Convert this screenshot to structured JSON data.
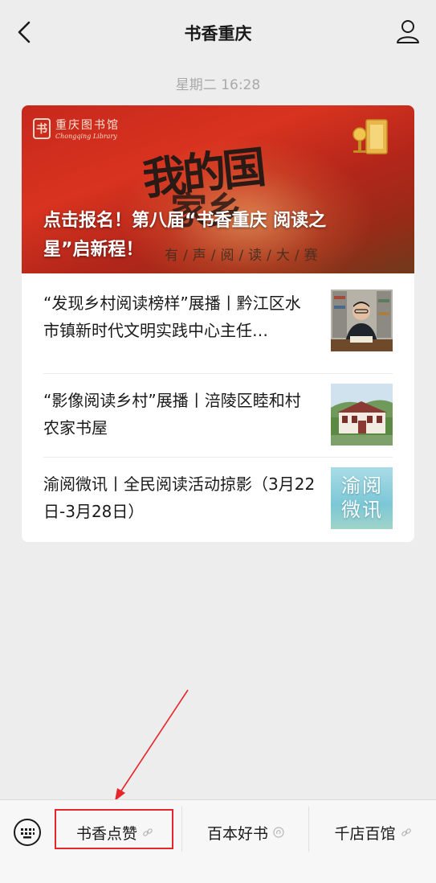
{
  "header": {
    "title": "书香重庆"
  },
  "timestamp": "星期二 16:28",
  "cover": {
    "title": "点击报名！第八届“书香重庆 阅读之星”启新程！",
    "logo_cn": "重庆图书馆",
    "logo_en": "Chongqing Library",
    "art_line1": "我的国",
    "art_line2": "家乡",
    "art_sub": "有/声/阅/读/大/赛"
  },
  "articles": [
    {
      "title": "“发现乡村阅读榜样”展播丨黔江区水市镇新时代文明实践中心主任…"
    },
    {
      "title": "“影像阅读乡村”展播丨涪陵区睦和村农家书屋"
    },
    {
      "title": "渝阅微讯丨全民阅读活动掠影（3月22日-3月28日）",
      "thumb_text": "渝阅微讯"
    }
  ],
  "menu": {
    "items": [
      {
        "label": "书香点赞"
      },
      {
        "label": "百本好书"
      },
      {
        "label": "千店百馆"
      }
    ]
  },
  "colors": {
    "background": "#ededed",
    "highlight": "#e5262a",
    "cover_red": "#c7281c"
  }
}
